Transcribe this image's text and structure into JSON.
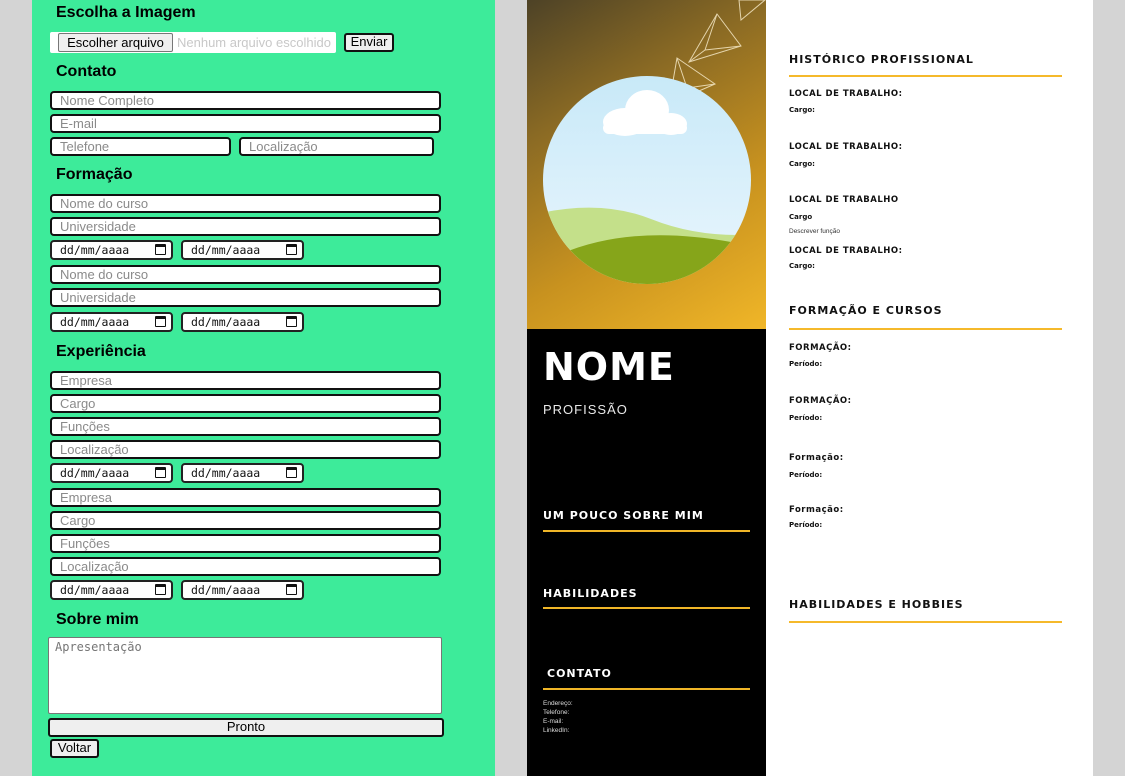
{
  "form": {
    "sections": {
      "image": "Escolha a Imagem",
      "contact": "Contato",
      "education": "Formação",
      "experience": "Experiência",
      "about": "Sobre mim"
    },
    "file": {
      "choose_label": "Escolher arquivo",
      "no_file": "Nenhum arquivo escolhido",
      "send_label": "Enviar"
    },
    "contact": {
      "name_ph": "Nome Completo",
      "email_ph": "E-mail",
      "phone_ph": "Telefone",
      "location_ph": "Localização"
    },
    "education": [
      {
        "course_ph": "Nome do curso",
        "university_ph": "Universidade",
        "start": "dd/mm/aaaa",
        "end": "dd/mm/aaaa"
      },
      {
        "course_ph": "Nome do curso",
        "university_ph": "Universidade",
        "start": "dd/mm/aaaa",
        "end": "dd/mm/aaaa"
      }
    ],
    "experience": [
      {
        "company_ph": "Empresa",
        "role_ph": "Cargo",
        "duties_ph": "Funções",
        "location_ph": "Localização",
        "start": "dd/mm/aaaa",
        "end": "dd/mm/aaaa"
      },
      {
        "company_ph": "Empresa",
        "role_ph": "Cargo",
        "duties_ph": "Funções",
        "location_ph": "Localização",
        "start": "dd/mm/aaaa",
        "end": "dd/mm/aaaa"
      }
    ],
    "about_ph": "Apresentação",
    "done_label": "Pronto",
    "back_label": "Voltar"
  },
  "resume": {
    "name": "NOME",
    "profession": "PROFISSÃO",
    "about_title": "UM POUCO SOBRE MIM",
    "skills_title": "HABILIDADES",
    "contact_title": "CONTATO",
    "contact_lines": [
      "Endereço:",
      "Telefone:",
      "E-mail:",
      "LinkedIn:"
    ],
    "history_title": "HISTÓRICO PROFISSIONAL",
    "jobs": [
      {
        "place": "LOCAL DE TRABALHO:",
        "role": "Cargo:",
        "desc": ""
      },
      {
        "place": "LOCAL DE TRABALHO:",
        "role": "Cargo:",
        "desc": ""
      },
      {
        "place": "LOCAL DE TRABALHO",
        "role": "Cargo",
        "desc": "Descrever função"
      },
      {
        "place": "LOCAL DE TRABALHO:",
        "role": "Cargo:",
        "desc": ""
      }
    ],
    "education_title": "FORMAÇÃO E CURSOS",
    "courses": [
      {
        "label": "FORMAÇÃO:",
        "period": "Período:"
      },
      {
        "label": "FORMAÇÃO:",
        "period": "Período:"
      },
      {
        "label": "Formação:",
        "period": "Período:"
      },
      {
        "label": "Formação:",
        "period": "Período:"
      }
    ],
    "hobbies_title": "HABILIDADES E HOBBIES"
  },
  "colors": {
    "form_bg": "#3deb9a",
    "accent": "#f0b628",
    "dark": "#000000"
  }
}
